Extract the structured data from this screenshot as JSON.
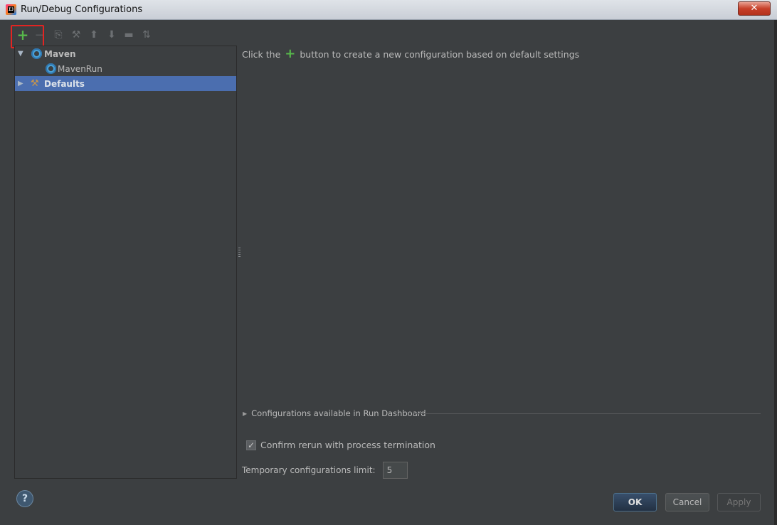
{
  "window": {
    "title": "Run/Debug Configurations",
    "close_symbol": "✕",
    "app_icon_text": "IJ"
  },
  "toolbar": {
    "add": {
      "symbol": "+",
      "icon": "add-icon",
      "color": "#57b84b"
    },
    "remove": {
      "symbol": "−",
      "icon": "remove-icon"
    },
    "copy": {
      "symbol": "⎘",
      "icon": "copy-icon"
    },
    "edit_defaults": {
      "symbol": "⚒",
      "icon": "wrench-icon"
    },
    "move_up": {
      "symbol": "⬆",
      "icon": "arrow-up-icon"
    },
    "move_down": {
      "symbol": "⬇",
      "icon": "arrow-down-icon"
    },
    "folder": {
      "symbol": "▬",
      "icon": "folder-icon"
    },
    "sort": {
      "symbol": "⇅",
      "icon": "sort-az-icon"
    }
  },
  "tree": {
    "items": [
      {
        "label": "Maven",
        "expanded": true,
        "icon": "maven-gear-icon",
        "bold": true,
        "selected": false,
        "arrow": "▼"
      },
      {
        "label": "MavenRun",
        "icon": "maven-gear-icon",
        "bold": false,
        "selected": false
      },
      {
        "label": "Defaults",
        "expanded": false,
        "icon": "wrench-icon",
        "bold": true,
        "selected": true,
        "arrow": "▶"
      }
    ]
  },
  "main": {
    "hint_before": "Click the",
    "hint_plus": "+",
    "hint_after": "button to create a new configuration based on default settings",
    "dashboard_arrow": "▶",
    "dashboard_label": "Configurations available in Run Dashboard",
    "confirm_rerun_label": "Confirm rerun with process termination",
    "confirm_rerun_checked": true,
    "checkmark": "✓",
    "temp_limit_label": "Temporary configurations limit:",
    "temp_limit_value": "5"
  },
  "footer": {
    "help_symbol": "?",
    "ok_label": "OK",
    "cancel_label": "Cancel",
    "apply_label": "Apply"
  },
  "colors": {
    "background": "#3c3f41",
    "selection": "#4b6eaf",
    "accent_green": "#57b84b",
    "highlight_red": "#e32422"
  }
}
